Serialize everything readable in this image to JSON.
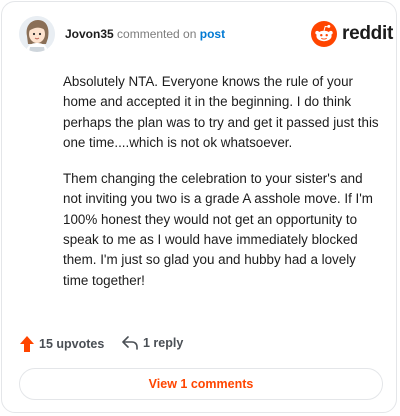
{
  "comment": {
    "username": "Jovon35",
    "action_text": " commented on ",
    "post_link": "post",
    "brand_name": "reddit",
    "paragraphs": [
      "Absolutely NTA. Everyone knows the rule of your home and accepted it in the beginning. I do think perhaps the plan was to try and get it passed just this one time....which is not ok whatsoever.",
      "Them changing the celebration to your sister's and not inviting you two is a grade A asshole move. If I'm 100% honest they would not get an opportunity to speak to me as I would have immediately blocked them. I'm just so glad you and hubby had a lovely time together!"
    ]
  },
  "footer": {
    "upvotes_label": "15 upvotes",
    "reply_label": "1 reply",
    "view_comments_label": "View 1 comments"
  },
  "icons": {
    "avatar": "user-avatar",
    "brand": "reddit-logo-icon",
    "upvote": "upvote-arrow-icon",
    "reply": "reply-arrow-icon"
  },
  "colors": {
    "accent": "#ff4500",
    "link": "#0079d3",
    "text": "#1c1c1c",
    "muted": "#7c7c7c"
  }
}
